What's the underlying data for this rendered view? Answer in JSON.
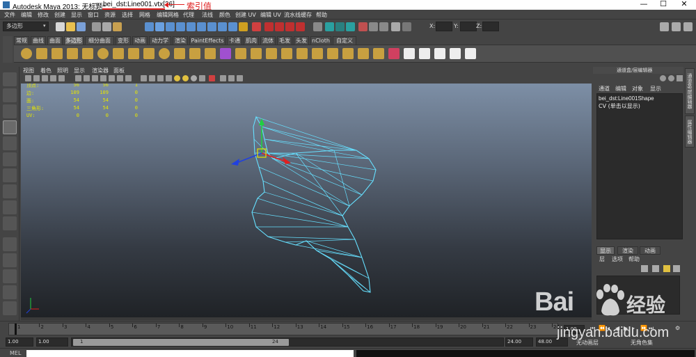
{
  "window": {
    "title": "Autodesk Maya 2013: 无标题*",
    "separator": "---",
    "selection": "bei_dst:Line001.vtx[36]",
    "annotation": "索引值",
    "controls": [
      "—",
      "☐",
      "✕"
    ]
  },
  "menubar": [
    "文件",
    "编辑",
    "修改",
    "创建",
    "显示",
    "窗口",
    "资源",
    "选择",
    "网格",
    "编辑网格",
    "代理",
    "法线",
    "颜色",
    "创建 UV",
    "编辑 UV",
    "流水线缓存",
    "帮助"
  ],
  "statusline": {
    "mode": "多边形",
    "x_label": "X:",
    "y_label": "Y:",
    "z_label": "Z:"
  },
  "shelf": {
    "tabs": [
      "常规",
      "曲线",
      "曲面",
      "多边形",
      "细分曲面",
      "变形",
      "动画",
      "动力学",
      "渲染",
      "PaintEffects",
      "卡通",
      "肌肉",
      "流体",
      "毛发",
      "头发",
      "nCloth",
      "自定义"
    ],
    "active_tab": 3
  },
  "panel": {
    "menus": [
      "视图",
      "着色",
      "照明",
      "显示",
      "渲染器",
      "面板"
    ]
  },
  "hud": {
    "rows": [
      {
        "label": "顶点:",
        "v1": "56",
        "v2": "56",
        "v3": "1"
      },
      {
        "label": "边:",
        "v1": "109",
        "v2": "109",
        "v3": "0"
      },
      {
        "label": "面:",
        "v1": "54",
        "v2": "54",
        "v3": "0"
      },
      {
        "label": "三角形:",
        "v1": "54",
        "v2": "54",
        "v3": "0"
      },
      {
        "label": "UV:",
        "v1": "0",
        "v2": "0",
        "v3": "0"
      }
    ]
  },
  "channelbox": {
    "header": "通道盒/层编辑器",
    "menus": [
      "通道",
      "编辑",
      "对象",
      "显示"
    ],
    "object_name": "bei_dst:Line001Shape",
    "object_info": "CV (单击以显示)"
  },
  "sidetabs": [
    "通道盒/层编辑器",
    "属性编辑器"
  ],
  "layers": {
    "tabs": [
      "显示",
      "渲染",
      "动画"
    ],
    "menus": [
      "层",
      "选项",
      "帮助"
    ]
  },
  "timeslider": {
    "ticks": [
      "1",
      "2",
      "3",
      "4",
      "5",
      "6",
      "7",
      "8",
      "9",
      "10",
      "11",
      "12",
      "13",
      "14",
      "15",
      "16",
      "17",
      "18",
      "19",
      "20",
      "21",
      "22",
      "23",
      "24"
    ],
    "current": "1.00"
  },
  "range": {
    "start": "1.00",
    "start2": "1.00",
    "handle_start": "1",
    "handle_end": "24",
    "end": "24.00",
    "end2": "48.00",
    "anim_layer": "无动画层",
    "char_set": "无角色集"
  },
  "cmdline": {
    "label": "MEL"
  },
  "watermark": {
    "brand": "Bai",
    "brand_cn": "经验",
    "url": "jingyan.baidu.com"
  },
  "colors": {
    "wire": "#66e0ff",
    "axis_x": "#e02020",
    "axis_y": "#20d040",
    "axis_z": "#2040e0",
    "hud": "#e6e600",
    "annotation": "#e02020"
  }
}
